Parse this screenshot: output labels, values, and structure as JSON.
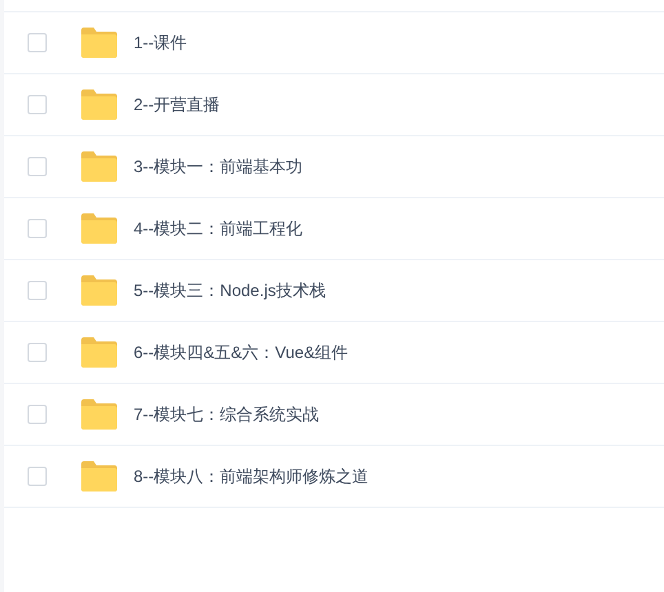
{
  "files": [
    {
      "name": "1--课件",
      "checked": false
    },
    {
      "name": "2--开营直播",
      "checked": false
    },
    {
      "name": "3--模块一：前端基本功",
      "checked": false
    },
    {
      "name": "4--模块二：前端工程化",
      "checked": false
    },
    {
      "name": "5--模块三：Node.js技术栈",
      "checked": false
    },
    {
      "name": "6--模块四&五&六：Vue&组件",
      "checked": false
    },
    {
      "name": "7--模块七：综合系统实战",
      "checked": false
    },
    {
      "name": "8--模块八：前端架构师修炼之道",
      "checked": false
    }
  ]
}
